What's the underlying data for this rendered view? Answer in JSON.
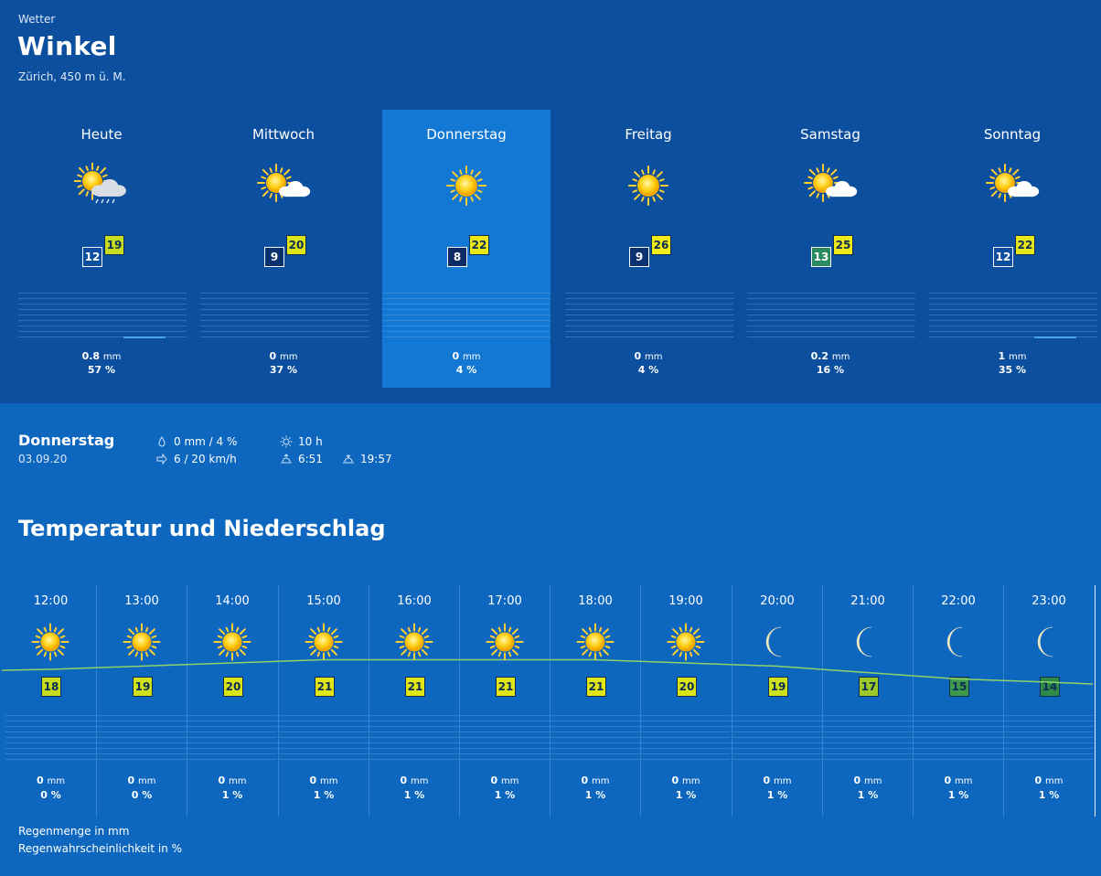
{
  "header": {
    "kicker": "Wetter",
    "place": "Winkel",
    "sub": "Zürich, 450 m ü. M."
  },
  "days": [
    {
      "name": "Heute",
      "icon": "sun-cloud-rain-icon",
      "min": "12",
      "max": "19",
      "min_color": "#0c4f9f",
      "max_color": "#c8dc1e",
      "mm": "0.8",
      "pct": "57 %",
      "rain_fraction": 0.25,
      "selected": false
    },
    {
      "name": "Mittwoch",
      "icon": "sun-cloud-icon",
      "min": "9",
      "max": "20",
      "min_color": "#0c3170",
      "max_color": "#dde414",
      "mm": "0",
      "pct": "37 %",
      "rain_fraction": 0,
      "selected": false
    },
    {
      "name": "Donnerstag",
      "icon": "sun-icon",
      "min": "8",
      "max": "22",
      "min_color": "#0c2a66",
      "max_color": "#e8e614",
      "mm": "0",
      "pct": "4 %",
      "rain_fraction": 0,
      "selected": true
    },
    {
      "name": "Freitag",
      "icon": "sun-icon",
      "min": "9",
      "max": "26",
      "min_color": "#0c3170",
      "max_color": "#f3ec14",
      "mm": "0",
      "pct": "4 %",
      "rain_fraction": 0,
      "selected": false
    },
    {
      "name": "Samstag",
      "icon": "sun-cloud-icon",
      "min": "13",
      "max": "25",
      "min_color": "#2c8a60",
      "max_color": "#f0ea14",
      "mm": "0.2",
      "pct": "16 %",
      "rain_fraction": 0,
      "selected": false
    },
    {
      "name": "Sonntag",
      "icon": "sun-cloud-icon",
      "min": "12",
      "max": "22",
      "min_color": "#0c4f9f",
      "max_color": "#e8e614",
      "mm": "1",
      "pct": "35 %",
      "rain_fraction": 0.25,
      "selected": false
    }
  ],
  "detail": {
    "day": "Donnerstag",
    "date": "03.09.20",
    "rain": "0 mm / 4 %",
    "wind": "6 / 20 km/h",
    "sunshine": "10 h",
    "sunrise": "6:51",
    "sunset": "19:57"
  },
  "section_title": "Temperatur und Niederschlag",
  "hours": [
    {
      "time": "12:00",
      "icon": "sun-icon",
      "temp": "18",
      "color": "#c8dc1e",
      "mm": "0",
      "pct": "0 %"
    },
    {
      "time": "13:00",
      "icon": "sun-icon",
      "temp": "19",
      "color": "#d0e01a",
      "mm": "0",
      "pct": "0 %"
    },
    {
      "time": "14:00",
      "icon": "sun-icon",
      "temp": "20",
      "color": "#dde414",
      "mm": "0",
      "pct": "1 %"
    },
    {
      "time": "15:00",
      "icon": "sun-icon",
      "temp": "21",
      "color": "#e2e514",
      "mm": "0",
      "pct": "1 %"
    },
    {
      "time": "16:00",
      "icon": "sun-icon",
      "temp": "21",
      "color": "#e2e514",
      "mm": "0",
      "pct": "1 %"
    },
    {
      "time": "17:00",
      "icon": "sun-icon",
      "temp": "21",
      "color": "#e2e514",
      "mm": "0",
      "pct": "1 %"
    },
    {
      "time": "18:00",
      "icon": "sun-icon",
      "temp": "21",
      "color": "#e2e514",
      "mm": "0",
      "pct": "1 %"
    },
    {
      "time": "19:00",
      "icon": "sun-icon",
      "temp": "20",
      "color": "#dde414",
      "mm": "0",
      "pct": "1 %"
    },
    {
      "time": "20:00",
      "icon": "moon-icon",
      "temp": "19",
      "color": "#d0e01a",
      "mm": "0",
      "pct": "1 %"
    },
    {
      "time": "21:00",
      "icon": "moon-icon",
      "temp": "17",
      "color": "#9cc828",
      "mm": "0",
      "pct": "1 %"
    },
    {
      "time": "22:00",
      "icon": "moon-icon",
      "temp": "15",
      "color": "#3d9a4a",
      "mm": "0",
      "pct": "1 %"
    },
    {
      "time": "23:00",
      "icon": "moon-icon",
      "temp": "14",
      "color": "#2e8a47",
      "mm": "0",
      "pct": "1 %"
    }
  ],
  "legend": {
    "rain_amount": "Regenmenge in mm",
    "rain_probability": "Regenwahrscheinlichkeit in %"
  },
  "units": {
    "mm": "mm"
  }
}
